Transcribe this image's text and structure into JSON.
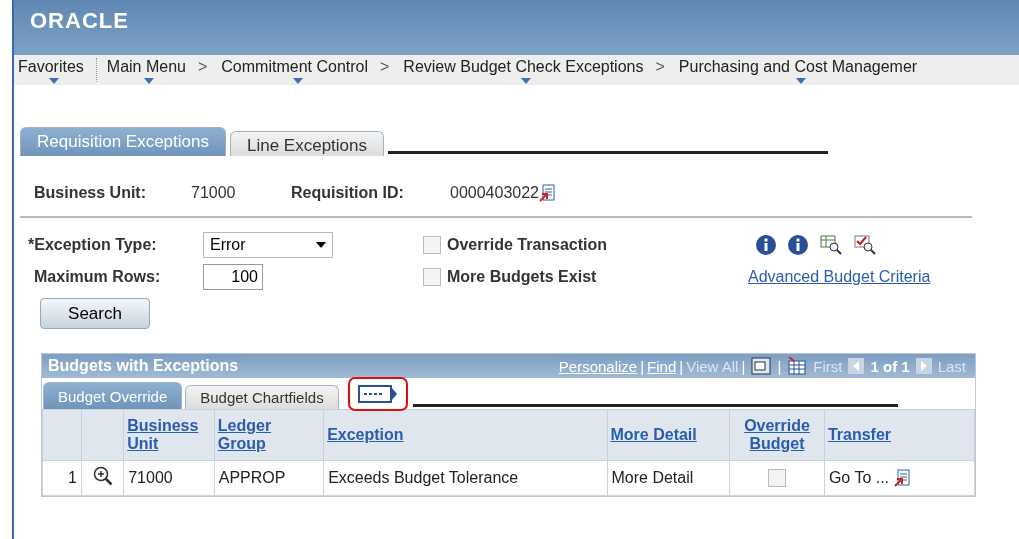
{
  "header": {
    "logo": "ORACLE"
  },
  "breadcrumbs": [
    {
      "label": "Favorites",
      "has_menu": true
    },
    {
      "label": "Main Menu",
      "has_menu": true
    },
    {
      "label": "Commitment Control",
      "has_menu": true,
      "separator": ">"
    },
    {
      "label": "Review Budget Check Exceptions",
      "has_menu": true,
      "separator": ">"
    },
    {
      "label": "Purchasing and Cost Managemer",
      "has_menu": true,
      "separator": ">"
    }
  ],
  "page_tabs": [
    {
      "label": "Requisition Exceptions",
      "selected": true
    },
    {
      "label": "Line Exceptions",
      "selected": false
    }
  ],
  "key_fields": [
    {
      "label": "Business Unit:",
      "value": "71000",
      "related": false
    },
    {
      "label": "Requisition ID:",
      "value": "0000403022",
      "related": true
    }
  ],
  "criteria": {
    "exception_type": {
      "label": "*Exception Type:",
      "value": "Error"
    },
    "maximum_rows": {
      "label": "Maximum Rows:",
      "value": "100"
    },
    "checkboxes": [
      {
        "label": "Override Transaction",
        "checked": false
      },
      {
        "label": "More Budgets Exist",
        "checked": false
      }
    ],
    "link": "Advanced Budget Criteria",
    "search_button": "Search"
  },
  "grid": {
    "title": "Budgets with Exceptions",
    "nav": {
      "personalize": "Personalize",
      "find": "Find",
      "view_all": "View All",
      "first": "First",
      "count": "1 of 1",
      "last": "Last",
      "divider": "|"
    },
    "tabs": [
      {
        "label": "Budget Override",
        "selected": true
      },
      {
        "label": "Budget Chartfields",
        "selected": false
      }
    ],
    "columns": [
      "Business Unit",
      "Ledger Group",
      "Exception",
      "More Detail",
      "Override Budget",
      "Transfer"
    ],
    "rows": [
      {
        "number": "1",
        "business_unit": "71000",
        "ledger_group": "APPROP",
        "exception": "Exceeds Budget Tolerance",
        "more_detail": "More Detail",
        "override": false,
        "transfer": "Go To ..."
      }
    ]
  }
}
